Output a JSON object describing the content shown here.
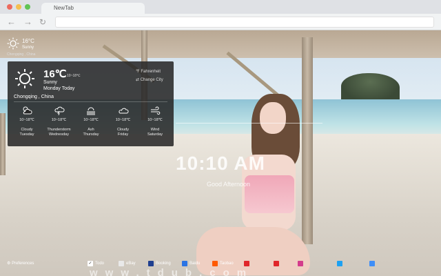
{
  "browser": {
    "tab_title": "NewTab",
    "back_icon": "arrow-left-icon",
    "forward_icon": "arrow-right-icon",
    "reload_icon": "reload-icon",
    "dot_colors": [
      "#ed6a5e",
      "#f5bf4f",
      "#61c454"
    ]
  },
  "mini_weather": {
    "temp": "16°C",
    "condition": "Sunny",
    "city": "Chongqing , China"
  },
  "weather_panel": {
    "temp": "16℃",
    "range": "10~18℃",
    "condition": "Sunny",
    "day": "Monday Today",
    "fahrenheit": "℉ Fahrenheit",
    "change_city": "⇄ Change City",
    "city": "Chongqing , China",
    "forecast": [
      {
        "icon": "cloudy-sun-icon",
        "range": "10~18℃",
        "condition": "Cloudy",
        "day": "Tuesday"
      },
      {
        "icon": "thunderstorm-icon",
        "range": "10~18℃",
        "condition": "Thunderstorm",
        "day": "Wednesday"
      },
      {
        "icon": "ash-icon",
        "range": "10~18℃",
        "condition": "Ash",
        "day": "Thursday"
      },
      {
        "icon": "cloud-icon",
        "range": "10~18℃",
        "condition": "Cloudy",
        "day": "Friday"
      },
      {
        "icon": "wind-icon",
        "range": "10~18℃",
        "condition": "Wind",
        "day": "Saturday"
      }
    ]
  },
  "clock": {
    "time": "10:10 AM",
    "greeting": "Good Afternoon"
  },
  "footer": {
    "preferences": "Preferences",
    "bookmarks": [
      {
        "label": "Todo",
        "color": "#ffffff"
      },
      {
        "label": "eBay",
        "color": "#e9e9e9"
      },
      {
        "label": "Booking",
        "color": "#1f3f8f"
      },
      {
        "label": "Baidu",
        "color": "#2b74e4"
      },
      {
        "label": "Taobao",
        "color": "#ff5a00"
      },
      {
        "label": "",
        "color": "#e0262a"
      },
      {
        "label": "",
        "color": "#e0262a"
      },
      {
        "label": "",
        "color": "#d43c8c"
      },
      {
        "label": "",
        "color": "#1da1f2"
      },
      {
        "label": "",
        "color": "#3e8ef7"
      }
    ]
  },
  "watermark": "www.tdub.com"
}
